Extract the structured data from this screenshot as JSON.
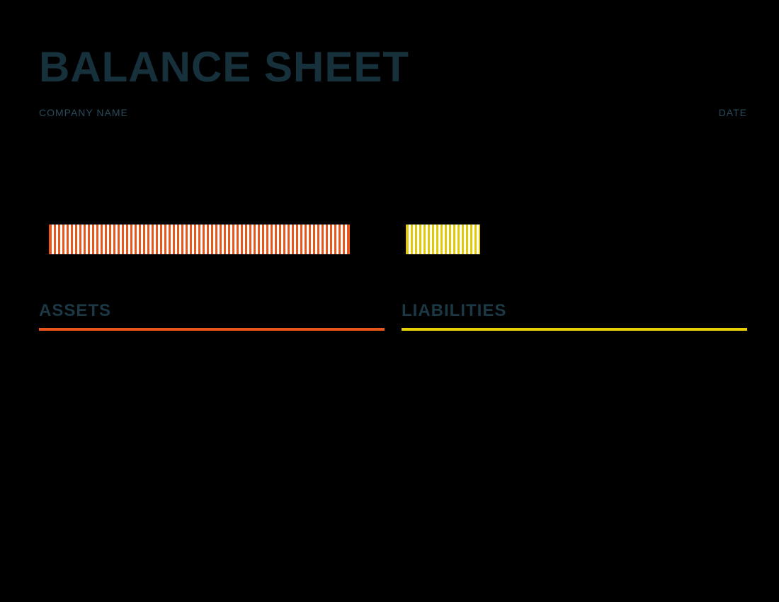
{
  "header": {
    "title": "BALANCE SHEET",
    "company_label": "COMPANY NAME",
    "date_label": "DATE"
  },
  "sections": {
    "assets_label": "ASSETS",
    "liabilities_label": "LIABILITIES"
  },
  "colors": {
    "assets": "#e8551b",
    "liabilities": "#e7cf06",
    "heading": "#17313c"
  },
  "chart_data": {
    "type": "bar",
    "categories": [
      "Assets",
      "Liabilities"
    ],
    "values": [
      85,
      21
    ],
    "title": "",
    "xlabel": "",
    "ylabel": "",
    "ylim": [
      0,
      100
    ]
  }
}
